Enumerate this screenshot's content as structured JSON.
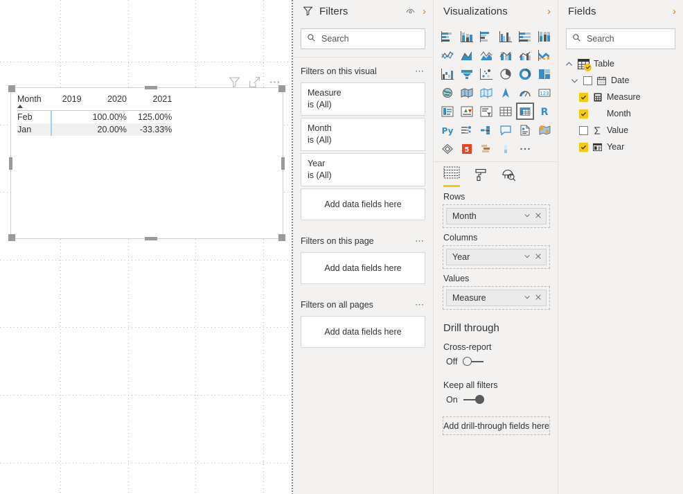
{
  "canvas": {
    "visual_header_icons": [
      "filter-icon",
      "focus-mode-icon",
      "more-options-icon"
    ],
    "matrix": {
      "row_header": "Month",
      "column_headers": [
        "2019",
        "2020",
        "2021"
      ],
      "rows": [
        {
          "label": "Feb",
          "values": [
            "",
            "100.00%",
            "125.00%"
          ]
        },
        {
          "label": "Jan",
          "values": [
            "",
            "20.00%",
            "-33.33%"
          ]
        }
      ],
      "sort_indicator": "ascending"
    }
  },
  "filters": {
    "title": "Filters",
    "search": {
      "placeholder": "Search"
    },
    "sections": [
      {
        "label": "Filters on this visual",
        "cards": [
          {
            "name": "Measure",
            "value": "is (All)"
          },
          {
            "name": "Month",
            "value": "is (All)"
          },
          {
            "name": "Year",
            "value": "is (All)"
          }
        ],
        "dropzone": "Add data fields here"
      },
      {
        "label": "Filters on this page",
        "cards": [],
        "dropzone": "Add data fields here"
      },
      {
        "label": "Filters on all pages",
        "cards": [],
        "dropzone": "Add data fields here"
      }
    ]
  },
  "visualizations": {
    "title": "Visualizations",
    "icons": [
      "stacked-bar-chart-icon",
      "stacked-column-chart-icon",
      "clustered-bar-chart-icon",
      "clustered-column-chart-icon",
      "100-stacked-bar-chart-icon",
      "100-stacked-column-chart-icon",
      "line-chart-icon",
      "area-chart-icon",
      "stacked-area-chart-icon",
      "line-and-stacked-column-chart-icon",
      "line-and-clustered-column-chart-icon",
      "ribbon-chart-icon",
      "waterfall-chart-icon",
      "funnel-chart-icon",
      "scatter-chart-icon",
      "pie-chart-icon",
      "donut-chart-icon",
      "treemap-icon",
      "map-icon",
      "filled-map-icon",
      "shape-map-icon",
      "arcgis-map-icon",
      "gauge-icon",
      "card-icon",
      "multi-row-card-icon",
      "kpi-icon",
      "slicer-icon",
      "table-icon",
      "matrix-icon",
      "r-script-visual-icon",
      "python-visual-icon",
      "decomposition-tree-icon",
      "key-influencers-icon",
      "qna-icon",
      "paginated-report-icon",
      "arcgis-maps-icon",
      "power-apps-icon",
      "html-viewer-icon",
      "gantt-chart-icon",
      "bullet-chart-icon",
      "more-visuals-icon"
    ],
    "selected_icon": "matrix-icon",
    "tabs": [
      "fields-tab-icon",
      "format-tab-icon",
      "analytics-tab-icon"
    ],
    "active_tab": "fields-tab-icon",
    "wells": [
      {
        "label": "Rows",
        "chip": "Month"
      },
      {
        "label": "Columns",
        "chip": "Year"
      },
      {
        "label": "Values",
        "chip": "Measure"
      }
    ],
    "drill_through": {
      "title": "Drill through",
      "cross_report": {
        "label": "Cross-report",
        "state": "Off"
      },
      "keep_all_filters": {
        "label": "Keep all filters",
        "state": "On"
      },
      "dropzone": "Add drill-through fields here"
    }
  },
  "fields": {
    "title": "Fields",
    "search": {
      "placeholder": "Search"
    },
    "tree": [
      {
        "label": "Table",
        "level": 0,
        "expanded": true,
        "checked": true,
        "icon": "table-icon"
      },
      {
        "label": "Date",
        "level": 1,
        "expanded": true,
        "checked": false,
        "icon": "calendar-icon"
      },
      {
        "label": "Measure",
        "level": 1,
        "checked": true,
        "icon": "measure-icon"
      },
      {
        "label": "Month",
        "level": 1,
        "checked": true,
        "icon": ""
      },
      {
        "label": "Value",
        "level": 1,
        "checked": false,
        "icon": "sigma-icon"
      },
      {
        "label": "Year",
        "level": 1,
        "checked": true,
        "icon": "hierarchy-date-icon"
      }
    ]
  },
  "colors": {
    "accent_yellow": "#f2c811",
    "accent_orange": "#d97706",
    "pane_bg": "#f3f2f1",
    "matrix_header_rule": "#a3d2ef"
  }
}
